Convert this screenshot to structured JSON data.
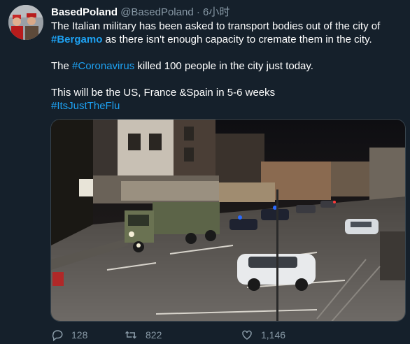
{
  "tweet": {
    "display_name": "BasedPoland",
    "handle": "@BasedPoland",
    "separator": "·",
    "time": "6小时",
    "line1": "The Italian military has been asked to transport bodies out of the city of",
    "hashtag_bergamo": "#Bergamo",
    "line2_rest": " as there isn't enough capacity to cremate them in the city.",
    "line3_pre": "The ",
    "hashtag_coronavirus": "#Coronavirus",
    "line3_rest": " killed 100 people in the city just today.",
    "line4": "This will be the US, France &Spain in 5-6 weeks",
    "hashtag_itsjusttheflu": "#ItsJustTheFlu"
  },
  "actions": {
    "reply_count": "128",
    "retweet_count": "822",
    "like_count": "1,146",
    "reply_icon": "reply-icon",
    "retweet_icon": "retweet-icon",
    "like_icon": "heart-icon",
    "share_icon": "share-icon"
  },
  "colors": {
    "background": "#15202b",
    "link": "#1da1f2",
    "muted": "#8899a6"
  }
}
